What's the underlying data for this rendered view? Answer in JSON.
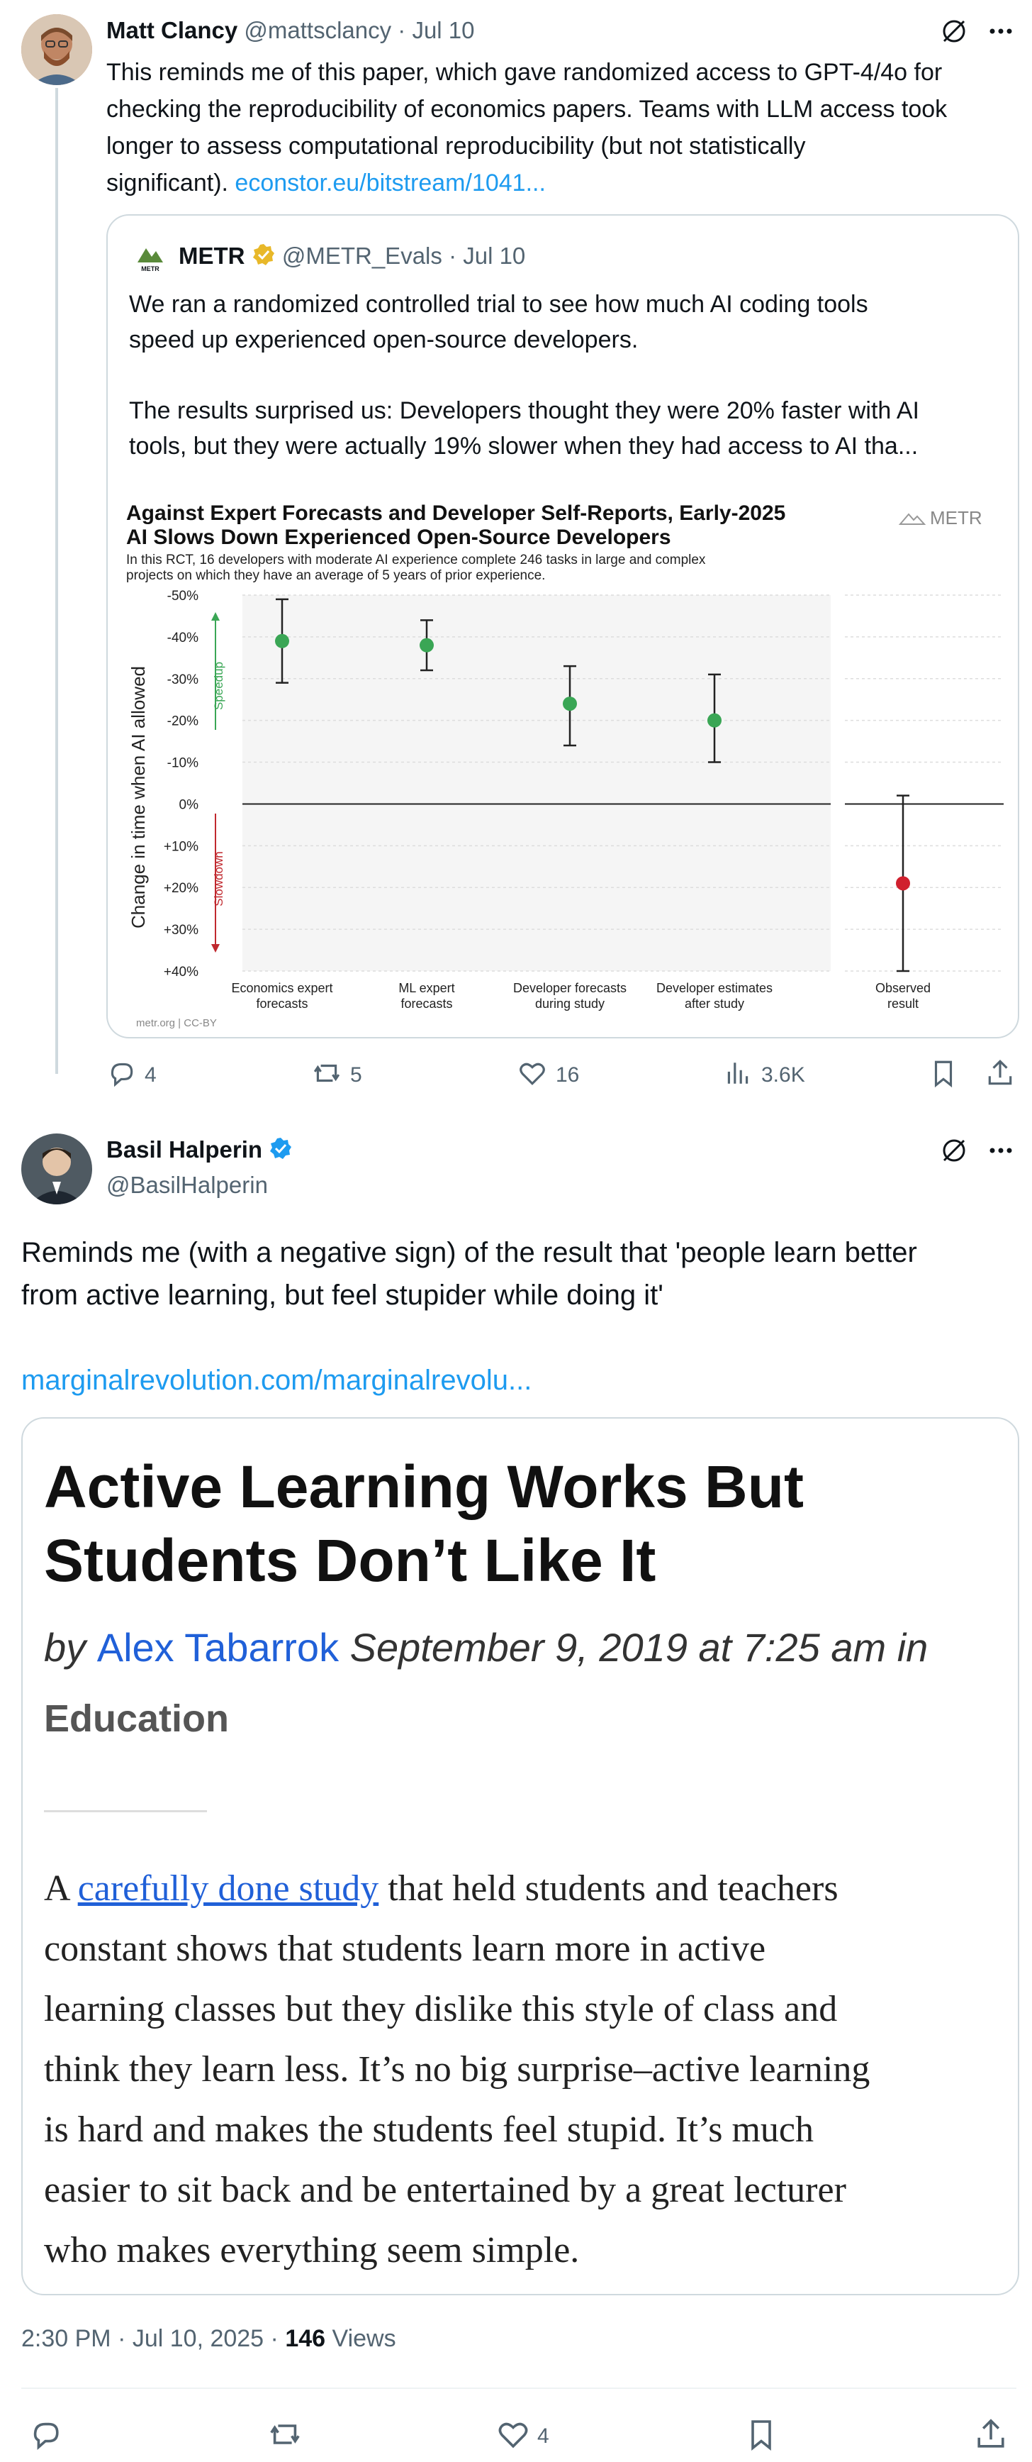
{
  "tweet1": {
    "author_name": "Matt Clancy",
    "handle": "@mattsclancy",
    "date": "· Jul 10",
    "text_lines": [
      "This reminds me of this paper, which gave randomized access to GPT-4/4o for",
      "checking the reproducibility of economics papers. Teams with LLM access took",
      "longer to assess computational reproducibility (but not statistically",
      "significant)."
    ],
    "link": "econstor.eu/bitstream/1041...",
    "quote": {
      "author_name": "METR",
      "handle": "@METR_Evals",
      "date": "· Jul 10",
      "logo_text": "METR",
      "text_lines": [
        "We ran a randomized controlled trial to see how much AI coding tools",
        "speed up experienced open-source developers.",
        "",
        "The results surprised us: Developers thought they were 20% faster with AI",
        "tools, but they were actually 19% slower when they had access to AI tha..."
      ]
    },
    "actions": {
      "replies": "4",
      "retweets": "5",
      "likes": "16",
      "views": "3.6K"
    }
  },
  "chart_data": {
    "type": "scatter",
    "title_line1": "Against Expert Forecasts and Developer Self-Reports, Early-2025",
    "title_line2": "AI Slows Down Experienced Open-Source Developers",
    "subtitle_line1": "In this RCT, 16 developers with moderate AI experience complete 246 tasks in large and complex",
    "subtitle_line2": "projects on which they have an average of 5 years of prior experience.",
    "brand": "METR",
    "ylabel": "Change in time when AI allowed",
    "speedup_label": "Speedup",
    "slowdown_label": "Slowdown",
    "footer": "metr.org  |  CC-BY",
    "ylim": [
      -50,
      40
    ],
    "y_ticks": [
      -50,
      -40,
      -30,
      -20,
      -10,
      0,
      10,
      20,
      30,
      40
    ],
    "y_tick_labels": [
      "-50%",
      "-40%",
      "-30%",
      "-20%",
      "-10%",
      "0%",
      "+10%",
      "+20%",
      "+30%",
      "+40%"
    ],
    "categories": [
      [
        "Economics expert",
        "forecasts"
      ],
      [
        "ML expert",
        "forecasts"
      ],
      [
        "Developer forecasts",
        "during study"
      ],
      [
        "Developer estimates",
        "after study"
      ],
      [
        "Observed",
        "result"
      ]
    ],
    "values": [
      -39,
      -38,
      -24,
      -20,
      19
    ],
    "ci_low": [
      -49,
      -44,
      -33,
      -31,
      -2
    ],
    "ci_high": [
      -29,
      -32,
      -14,
      -10,
      40
    ],
    "point_colors": [
      "#3aa655",
      "#3aa655",
      "#3aa655",
      "#3aa655",
      "#d0202e"
    ]
  },
  "tweet2": {
    "author_name": "Basil Halperin",
    "handle": "@BasilHalperin",
    "text_lines": [
      "Reminds me (with a negative sign) of the result that 'people learn better",
      "from active learning, but feel stupider while doing it'"
    ],
    "link": "marginalrevolution.com/marginalrevolu...",
    "article": {
      "title_line1": "Active Learning Works But",
      "title_line2": "Students Don’t Like It",
      "by": "by",
      "author": "Alex Tabarrok",
      "date": "September 9, 2019 at 7:25 am in",
      "category": "Education",
      "body_first": "A ",
      "body_link": "carefully done study",
      "body_line1_rest": " that held students and teachers",
      "body_lines": [
        "constant shows that students learn more in active",
        "learning classes but they dislike this style of class and",
        "think they learn less. It’s no big surprise–active learning",
        "is hard and makes the students feel stupid. It’s much",
        "easier to sit back and be entertained by a great lecturer",
        "who makes everything seem simple."
      ]
    },
    "timestamp": "2:30 PM · Jul 10, 2025 ·",
    "views_count": "146",
    "views_label": "Views",
    "actions": {
      "likes": "4"
    }
  },
  "colors": {
    "accent": "#1d9bf0",
    "text": "#0f1419",
    "muted": "#536471",
    "green": "#3aa655",
    "red": "#d0202e",
    "verified_gold": "#e8b829"
  }
}
